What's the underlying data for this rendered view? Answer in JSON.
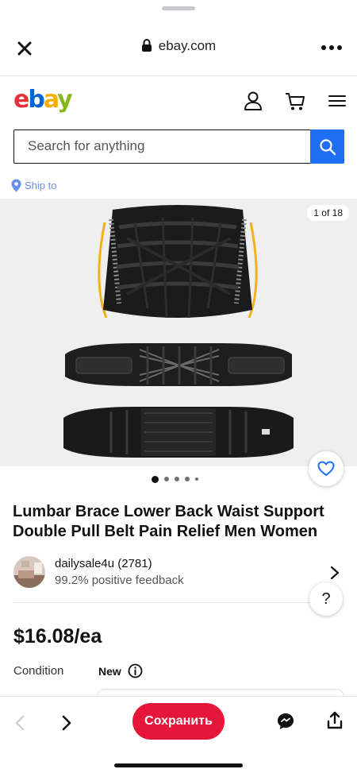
{
  "browser": {
    "url": "ebay.com",
    "close_icon": "close-icon",
    "lock_icon": "lock-icon",
    "more_icon": "more-icon"
  },
  "header": {
    "logo": {
      "e": "e",
      "b": "b",
      "a": "a",
      "y": "y"
    },
    "logo_colors": {
      "e": "#e53238",
      "b": "#0064d2",
      "a": "#f5af02",
      "y": "#86b817"
    },
    "icons": [
      "account-icon",
      "cart-icon",
      "menu-icon"
    ]
  },
  "search": {
    "placeholder": "Search for anything",
    "button_color": "#1f6ff5"
  },
  "ship_to": {
    "label": "Ship to"
  },
  "gallery": {
    "counter": "1 of 18",
    "total_dots": 5,
    "active_dot": 1
  },
  "product": {
    "title": "Lumbar Brace Lower Back Waist Support Double Pull Belt Pain Relief Men Women",
    "price": "$16.08/ea",
    "condition_label": "Condition",
    "condition_value": "New"
  },
  "seller": {
    "name": "dailysale4u (2781)",
    "feedback": "99.2% positive feedback"
  },
  "help": {
    "label": "?"
  },
  "bottom_bar": {
    "save_label": "Сохранить",
    "save_color": "#e5153b"
  }
}
